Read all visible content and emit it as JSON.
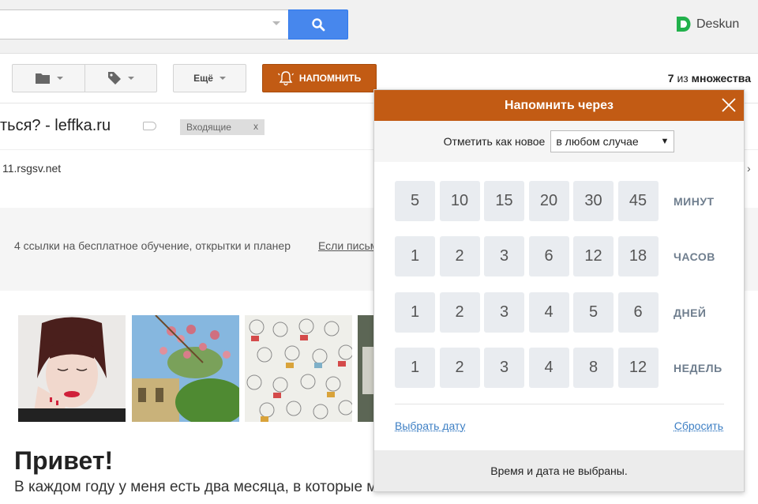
{
  "header": {
    "search": {
      "value": "",
      "placeholder": ""
    },
    "brand": {
      "name": "Deskun",
      "logo_color": "#22b14c"
    }
  },
  "toolbar": {
    "folder_icon": "folder-icon",
    "label_icon": "tag-icon",
    "more_label": "Ещё",
    "remind_label": "НАПОМНИТЬ",
    "remind_color": "#c25b14",
    "count_prefix": "7",
    "count_mid": "из",
    "count_suffix": "множества"
  },
  "email": {
    "subject": "ться? - leffka.ru",
    "label_chip": "Входящие",
    "label_chip_close": "x",
    "sender": "11.rsgsv.net",
    "right_chevron": "›",
    "preheader_text": "4 ссылки на бесплатное обучение, открытки и планер",
    "preheader_link": "Если письмо откройте его",
    "greeting": "Привет!",
    "body_text": "В каждом году у меня есть два месяца, в которые мне особенно хочется"
  },
  "reminder": {
    "title": "Напомнить через",
    "mark_label": "Отметить как новое",
    "mark_option": "в любом случае",
    "rows": [
      {
        "values": [
          "5",
          "10",
          "15",
          "20",
          "30",
          "45"
        ],
        "unit": "МИНУТ"
      },
      {
        "values": [
          "1",
          "2",
          "3",
          "6",
          "12",
          "18"
        ],
        "unit": "ЧАСОВ"
      },
      {
        "values": [
          "1",
          "2",
          "3",
          "4",
          "5",
          "6"
        ],
        "unit": "ДНЕЙ"
      },
      {
        "values": [
          "1",
          "2",
          "3",
          "4",
          "8",
          "12"
        ],
        "unit": "НЕДЕЛЬ"
      }
    ],
    "pick_date": "Выбрать дату",
    "reset": "Сбросить",
    "status": "Время и дата не выбраны."
  }
}
